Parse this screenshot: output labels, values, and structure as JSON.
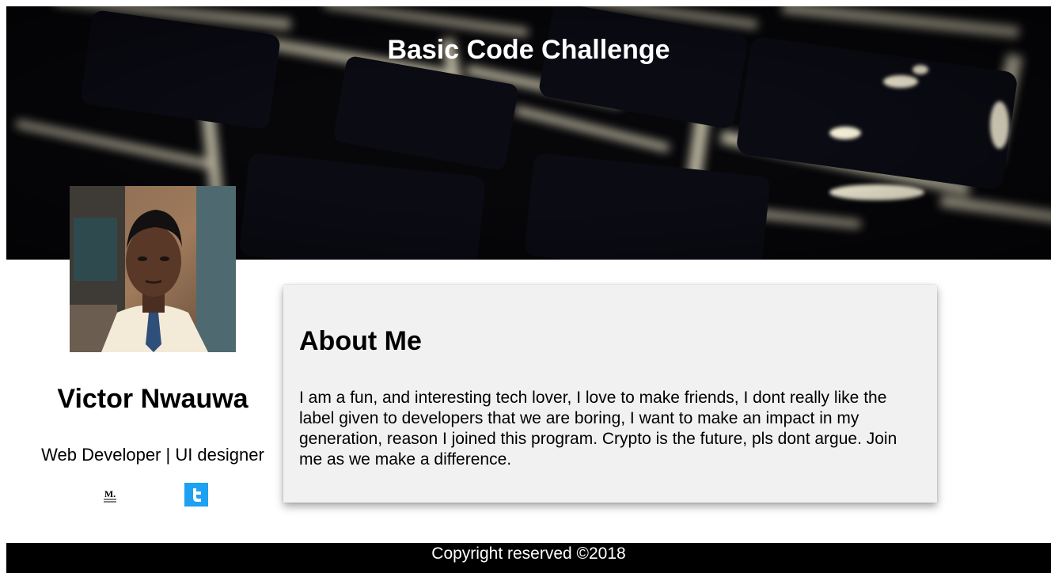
{
  "header": {
    "title": "Basic Code Challenge",
    "background": "keyboard-photo"
  },
  "profile": {
    "name": "Victor Nwauwa",
    "role": "Web Developer | UI designer",
    "avatar": "profile-photo"
  },
  "social": {
    "medium_icon": "medium-icon",
    "medium_glyph": "M.",
    "twitter_icon": "twitter-icon",
    "twitter_color": "#1da1f2"
  },
  "about": {
    "heading": "About Me",
    "text": "I am a fun, and interesting tech lover, I love to make friends, I dont really like the label given to developers that we are boring, I want to make an impact in my generation, reason I joined this program. Crypto is the future, pls dont argue. Join me as we make a difference."
  },
  "footer": {
    "text": "Copyright reserved ©2018"
  },
  "colors": {
    "card_bg": "#f1f1f1",
    "footer_bg": "#000000",
    "text": "#000000"
  }
}
